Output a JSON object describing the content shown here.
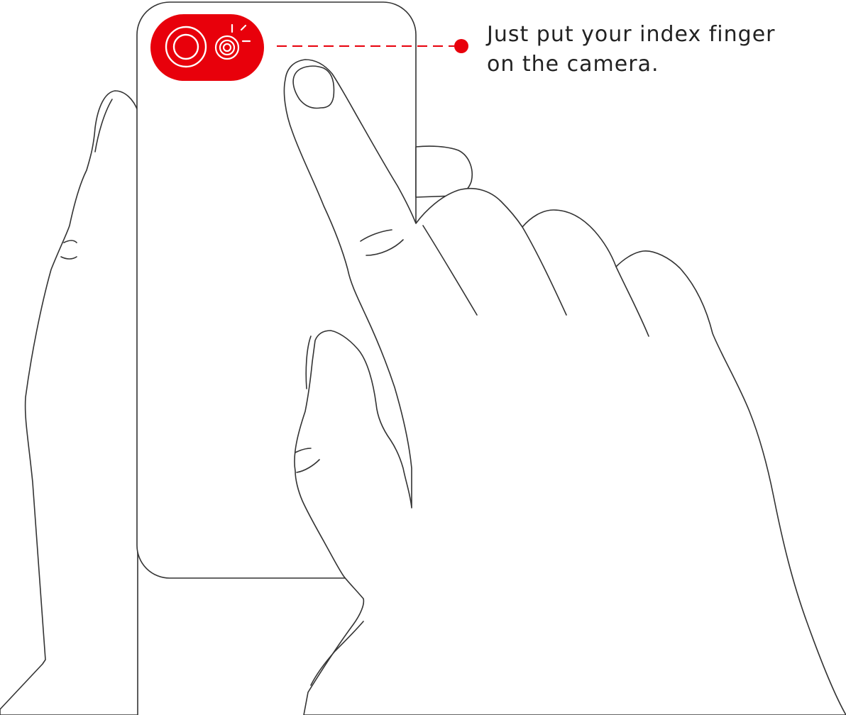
{
  "callout": {
    "line1": "Just put your index finger",
    "line2": "on the camera."
  },
  "icons": {
    "lens": "camera-lens-icon",
    "flash": "flash-icon"
  },
  "colors": {
    "accent": "#e8000b",
    "outline": "#333333",
    "background": "#ffffff"
  }
}
